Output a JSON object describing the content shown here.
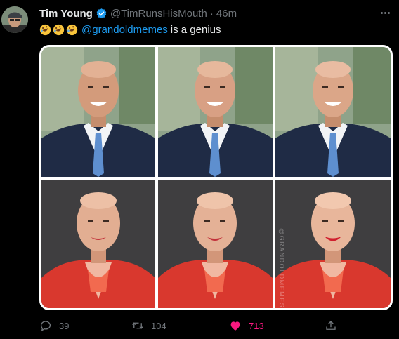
{
  "tweet": {
    "author_name": "Tim Young",
    "author_handle": "@TimRunsHisMouth",
    "separator": "·",
    "time": "46m",
    "mention": "@grandoldmemes",
    "text_after_mention": "is a genius",
    "emojis": [
      "rofl-emoji",
      "rofl-emoji",
      "rofl-emoji"
    ],
    "watermark": "@GRANDOLDMEMES"
  },
  "stats": {
    "replies": "39",
    "retweets": "104",
    "likes": "713"
  },
  "colors": {
    "background": "#000000",
    "accent": "#1d9bf0",
    "like": "#f91880",
    "muted": "#71767b",
    "jacket_blue": "#1f2b45",
    "jacket_red": "#d9382e"
  }
}
